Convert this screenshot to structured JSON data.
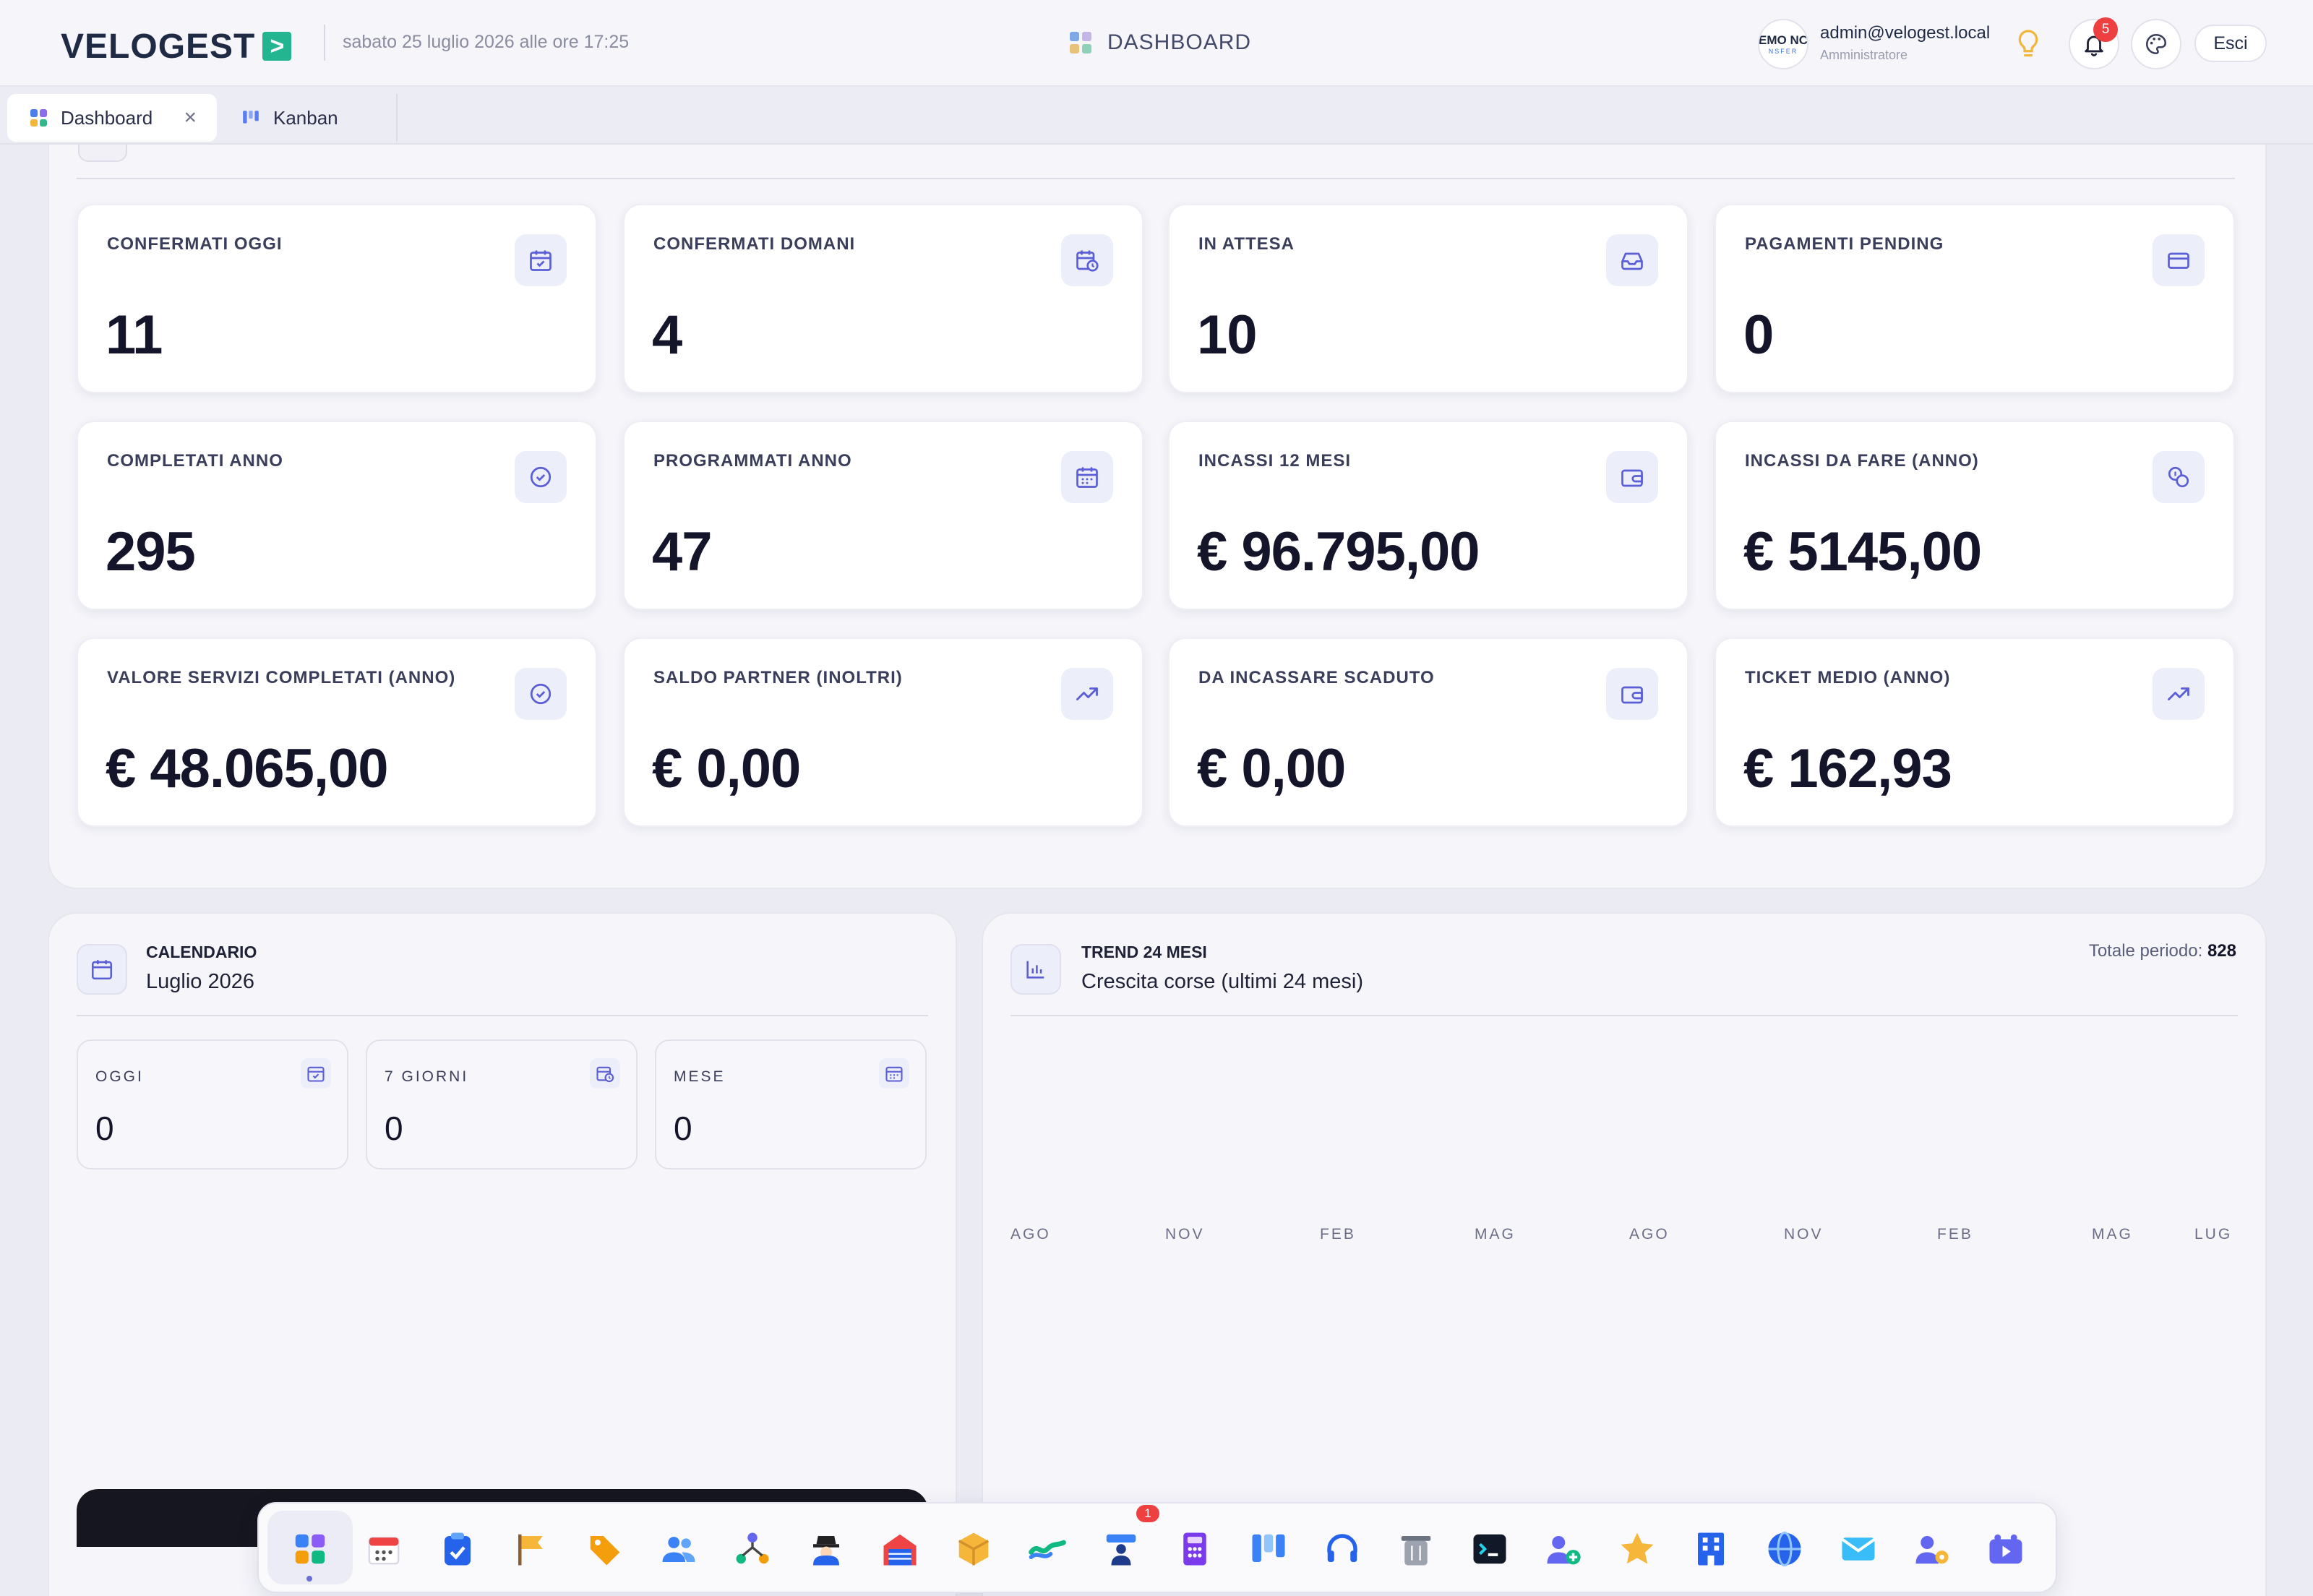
{
  "header": {
    "logo_text": "VELOGEST",
    "logo_badge": ">",
    "datetime": "sabato 25 luglio 2026 alle ore 17:25",
    "page_title": "DASHBOARD",
    "avatar_line1": "EMO NC",
    "avatar_line2": "NSFER",
    "user_email": "admin@velogest.local",
    "user_role": "Amministratore",
    "notification_count": "5",
    "logout_label": "Esci"
  },
  "tabs": [
    {
      "label": "Dashboard",
      "close": "×"
    },
    {
      "label": "Kanban"
    }
  ],
  "kpis": [
    {
      "label": "CONFERMATI OGGI",
      "value": "11",
      "icon": "calendar-check-icon"
    },
    {
      "label": "CONFERMATI DOMANI",
      "value": "4",
      "icon": "calendar-clock-icon"
    },
    {
      "label": "IN ATTESA",
      "value": "10",
      "icon": "inbox-icon"
    },
    {
      "label": "PAGAMENTI PENDING",
      "value": "0",
      "icon": "credit-card-icon"
    },
    {
      "label": "COMPLETATI ANNO",
      "value": "295",
      "icon": "check-circle-icon"
    },
    {
      "label": "PROGRAMMATI ANNO",
      "value": "47",
      "icon": "calendar-icon"
    },
    {
      "label": "INCASSI 12 MESI",
      "value": "€ 96.795,00",
      "icon": "wallet-icon"
    },
    {
      "label": "INCASSI DA FARE (ANNO)",
      "value": "€ 5145,00",
      "icon": "coins-icon"
    },
    {
      "label": "VALORE SERVIZI COMPLETATI (ANNO)",
      "value": "€ 48.065,00",
      "icon": "check-circle-icon"
    },
    {
      "label": "SALDO PARTNER (INOLTRI)",
      "value": "€ 0,00",
      "icon": "trending-up-icon"
    },
    {
      "label": "DA INCASSARE SCADUTO",
      "value": "€ 0,00",
      "icon": "wallet-icon"
    },
    {
      "label": "TICKET MEDIO (ANNO)",
      "value": "€ 162,93",
      "icon": "trending-up-icon"
    }
  ],
  "calendar": {
    "overline": "CALENDARIO",
    "title": "Luglio 2026",
    "cards": [
      {
        "label": "OGGI",
        "value": "0"
      },
      {
        "label": "7 GIORNI",
        "value": "0"
      },
      {
        "label": "MESE",
        "value": "0"
      }
    ]
  },
  "trend": {
    "overline": "TREND 24 MESI",
    "title": "Crescita corse (ultimi 24 mesi)",
    "total_label": "Totale periodo:",
    "total_value": "828",
    "axis_labels": [
      "AGO",
      "NOV",
      "FEB",
      "MAG",
      "AGO",
      "NOV",
      "FEB",
      "MAG",
      "LUG"
    ]
  },
  "dock": {
    "badge": "1",
    "items": [
      "dashboard-icon",
      "calendar-icon",
      "clipboard-icon",
      "flag-icon",
      "tag-icon",
      "users-icon",
      "network-icon",
      "agent-icon",
      "garage-icon",
      "package-icon",
      "route-icon",
      "driver-icon",
      "calculator-icon",
      "kanban-icon",
      "headset-icon",
      "trash-icon",
      "terminal-icon",
      "add-user-icon",
      "star-icon",
      "building-icon",
      "globe-icon",
      "mail-icon",
      "user-settings-icon",
      "video-icon"
    ]
  },
  "colors": {
    "accent": "#6366f1",
    "logo_badge": "#22b58f",
    "notification": "#ee4040",
    "background": "#ebebf4"
  }
}
